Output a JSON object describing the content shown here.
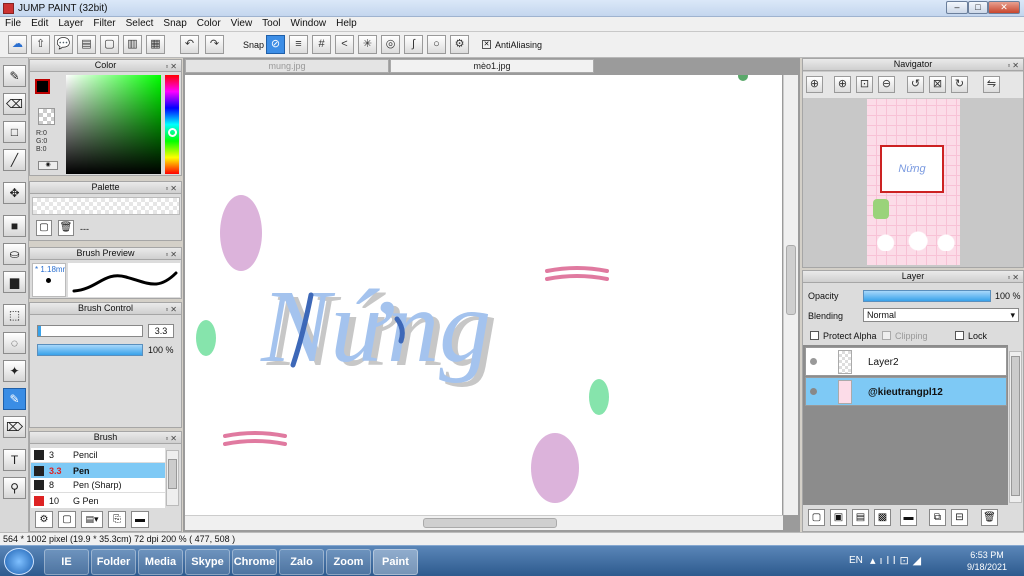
{
  "window": {
    "title": "JUMP PAINT (32bit)",
    "minimize": "–",
    "maximize": "□",
    "close": "✕"
  },
  "menu": [
    "File",
    "Edit",
    "Layer",
    "Filter",
    "Select",
    "Snap",
    "Color",
    "View",
    "Tool",
    "Window",
    "Help"
  ],
  "toolbar": {
    "snap_label": "Snap",
    "antialias_label": "AntiAliasing"
  },
  "color_panel": {
    "title": "Color",
    "r": "R:0",
    "g": "G:0",
    "b": "B:0",
    "fg": "#000000",
    "bg": "#ffffff"
  },
  "palette_panel": {
    "title": "Palette",
    "empty": "---"
  },
  "brush_preview": {
    "title": "Brush Preview",
    "size": "* 1.18mm"
  },
  "brush_control": {
    "title": "Brush Control",
    "size_value": "3.3",
    "opacity_value": "100 %"
  },
  "brush_panel": {
    "title": "Brush",
    "items": [
      {
        "size": "3",
        "name": "Pencil",
        "color": "#222222"
      },
      {
        "size": "3.3",
        "name": "Pen",
        "color": "#222222"
      },
      {
        "size": "8",
        "name": "Pen (Sharp)",
        "color": "#222222"
      },
      {
        "size": "10",
        "name": "G Pen",
        "color": "#dd2222"
      }
    ]
  },
  "canvas": {
    "tabs": [
      "mung.jpg",
      "mèo1.jpg"
    ],
    "active_tab": 1
  },
  "navigator": {
    "title": "Navigator",
    "thumb_text": "Nứng"
  },
  "layer_panel": {
    "title": "Layer",
    "opacity_label": "Opacity",
    "opacity_value": "100 %",
    "blending_label": "Blending",
    "blending_value": "Normal",
    "protect_alpha": "Protect Alpha",
    "clipping": "Clipping",
    "lock": "Lock",
    "layers": [
      {
        "name": "Layer2",
        "selected": false
      },
      {
        "name": "@kieutrangpl12",
        "selected": true
      }
    ]
  },
  "status": {
    "text": "564 * 1002 pixel   (19.9 * 35.3cm)   72 dpi   200 %   ( 477, 508 )"
  },
  "taskbar": {
    "lang": "EN",
    "time": "6:53 PM",
    "date": "9/18/2021",
    "apps": [
      "IE",
      "Folder",
      "Media",
      "Skype",
      "Chrome",
      "Zalo",
      "Zoom",
      "Paint"
    ]
  },
  "colors": {
    "accent": "#3a8de5",
    "pink": "#e07aa0",
    "lavender": "#d9a9d6",
    "mint": "#7fe0a6",
    "blue_text": "#a4c3ee",
    "dark_blue": "#3d68b8"
  }
}
